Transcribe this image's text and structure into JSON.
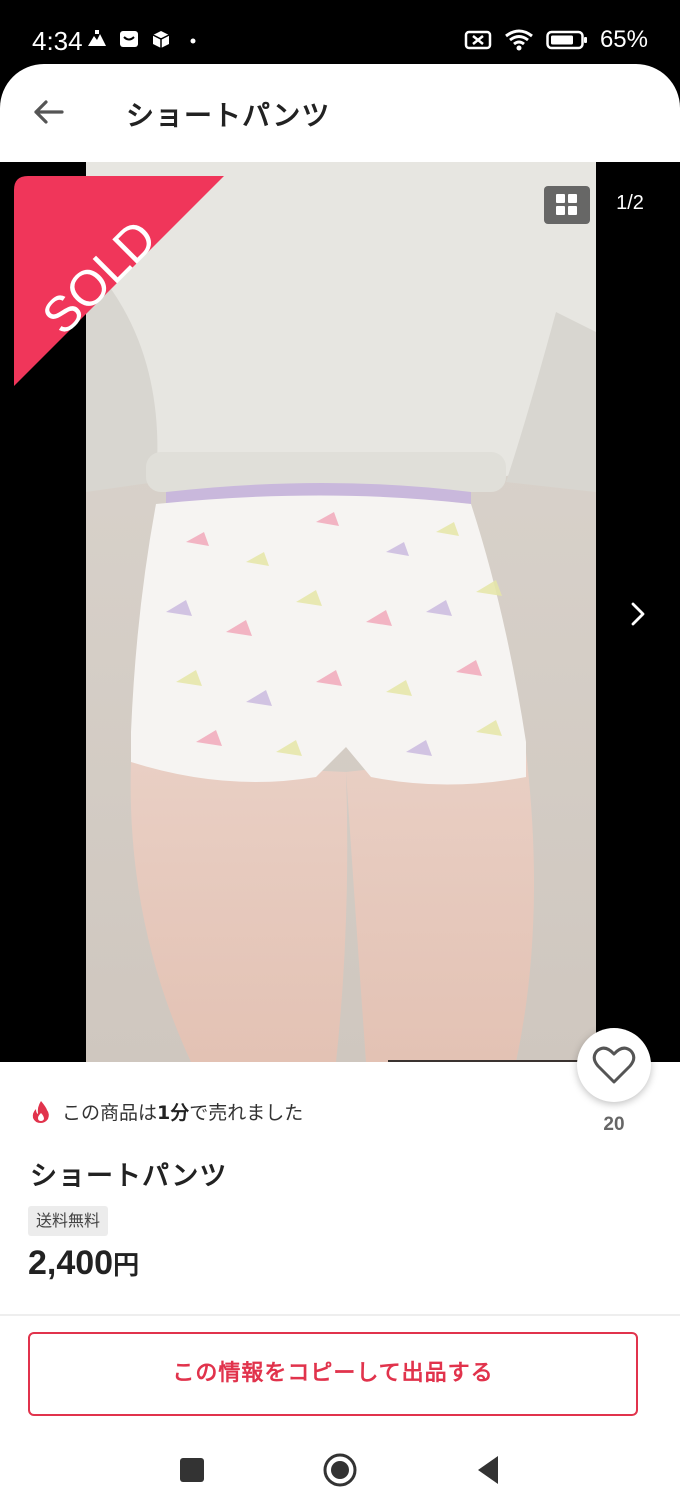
{
  "status_bar": {
    "time": "4:34",
    "battery": "65%",
    "left_icons": [
      "mountain-icon",
      "mail-icon",
      "box-icon",
      "dot-icon"
    ],
    "right_icons": [
      "no-sim-icon",
      "wifi-icon",
      "battery-icon"
    ]
  },
  "header": {
    "title": "ショートパンツ",
    "back_icon": "arrow-left-icon"
  },
  "carousel": {
    "sold_label": "SOLD",
    "page_counter": "1/2",
    "current_page": 1,
    "total_pages": 2,
    "grid_icon": "grid-icon",
    "next_icon": "chevron-right-icon"
  },
  "like": {
    "count": "20",
    "icon": "heart-outline-icon"
  },
  "product": {
    "sold_notice_prefix": "この商品は",
    "sold_notice_time": "1分",
    "sold_notice_suffix": "で売れました",
    "title": "ショートパンツ",
    "shipping_badge": "送料無料",
    "price": "2,400",
    "price_unit": "円"
  },
  "actions": {
    "copy_listing": "この情報をコピーして出品する"
  },
  "colors": {
    "accent": "#e1334c",
    "sold_ribbon": "#f0365a"
  }
}
